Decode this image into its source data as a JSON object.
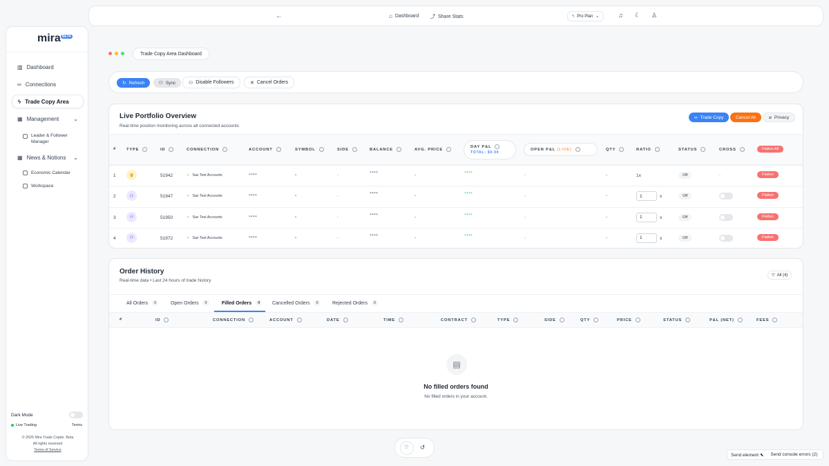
{
  "topbar": {
    "dashboard": "Dashboard",
    "share": "Share Stats",
    "plan": "Pro Plan"
  },
  "sidebar": {
    "logo": "mira",
    "logo_badge": "BETA",
    "items": [
      {
        "label": "Dashboard",
        "icon": "bar-chart-icon"
      },
      {
        "label": "Connections",
        "icon": "link-icon"
      },
      {
        "label": "Trade Copy Area",
        "icon": "bolt-icon"
      },
      {
        "label": "Management",
        "icon": "grid-icon"
      },
      {
        "label": "News & Notions",
        "icon": "grid-icon"
      }
    ],
    "sub_management": [
      "Leader & Follower",
      "Manager"
    ],
    "sub_news": [
      "Economic Calendar",
      "Workspace"
    ],
    "dark_mode": "Dark Mode",
    "live_trading": "Live Trading",
    "terms": "Terms",
    "footer": [
      "© 2025 Mira Trade Copier. Beta",
      "All rights reserved",
      "Terms of Service"
    ]
  },
  "breadcrumb": "Trade Copy Area Dashboard",
  "toolbar": {
    "refresh": "Refresh",
    "sync": "Sync",
    "disable": "Disable Followers",
    "cancel": "Cancel Orders"
  },
  "portfolio": {
    "title": "Live Portfolio Overview",
    "subtitle": "Real-time position monitoring across all connected accounts",
    "btn_trade_copy": "Trade Copy",
    "btn_cancel_all": "Cancel All",
    "btn_privacy": "Privacy",
    "headers": {
      "num": "#",
      "type": "Type",
      "id": "ID",
      "connection": "Connection",
      "account": "Account",
      "symbol": "Symbol",
      "side": "Side",
      "balance": "Balance",
      "avg_price": "Avg. Price",
      "day_pl": "Day P&L",
      "day_total": "TOTAL: $0.00",
      "open_pl": "Open P&L",
      "open_live": "(LIVE)",
      "qty": "Qty",
      "ratio": "Ratio",
      "status": "Status",
      "cross": "Cross",
      "flatten_all": "Flatten All"
    },
    "rows": [
      {
        "num": "1",
        "id": "51942",
        "connection": "Sav Test Accounts",
        "account": "****",
        "symbol": "-",
        "side": "-",
        "balance": "****",
        "avg": "-",
        "day": "****",
        "open": "-",
        "qty": "-",
        "ratio": "1x",
        "status": "Off",
        "cross": "-",
        "flatten": "Flatten"
      },
      {
        "num": "2",
        "id": "51947",
        "connection": "Sav Test Accounts",
        "account": "****",
        "symbol": "-",
        "side": "-",
        "balance": "****",
        "avg": "-",
        "day": "****",
        "open": "-",
        "qty": "-",
        "ratio": "1",
        "ratio_x": "x",
        "status": "Off",
        "flatten": "Flatten"
      },
      {
        "num": "3",
        "id": "51950",
        "connection": "Sav Test Accounts",
        "account": "****",
        "symbol": "-",
        "side": "-",
        "balance": "****",
        "avg": "-",
        "day": "****",
        "open": "-",
        "qty": "-",
        "ratio": "1",
        "ratio_x": "x",
        "status": "Off",
        "flatten": "Flatten"
      },
      {
        "num": "4",
        "id": "51972",
        "connection": "Sav Test Accounts",
        "account": "****",
        "symbol": "-",
        "side": "-",
        "balance": "****",
        "avg": "-",
        "day": "****",
        "open": "-",
        "qty": "-",
        "ratio": "1",
        "ratio_x": "x",
        "status": "Off",
        "flatten": "Flatten"
      }
    ]
  },
  "orders": {
    "title": "Order History",
    "subtitle": "Real-time data • Last 24 hours of trade history",
    "filter": "All (4)",
    "tabs": [
      {
        "label": "All Orders",
        "count": "0"
      },
      {
        "label": "Open Orders",
        "count": "0"
      },
      {
        "label": "Filled Orders",
        "count": "0"
      },
      {
        "label": "Cancelled Orders",
        "count": "0"
      },
      {
        "label": "Rejected Orders",
        "count": "0"
      }
    ],
    "headers": [
      "#",
      "ID",
      "Connection",
      "Account",
      "Date",
      "Time",
      "Contract",
      "Type",
      "Side",
      "Qty",
      "Price",
      "Status",
      "P&L (Net)",
      "Fees"
    ],
    "empty_title": "No filled orders found",
    "empty_sub": "No filled orders in your account."
  },
  "bottom": {
    "send_element": "Send element",
    "send_errors": "Send console errors (2)"
  },
  "colors": {
    "accent": "#3b82f6",
    "orange": "#f97316",
    "flatten": "#f87171",
    "green": "#22c55e"
  }
}
